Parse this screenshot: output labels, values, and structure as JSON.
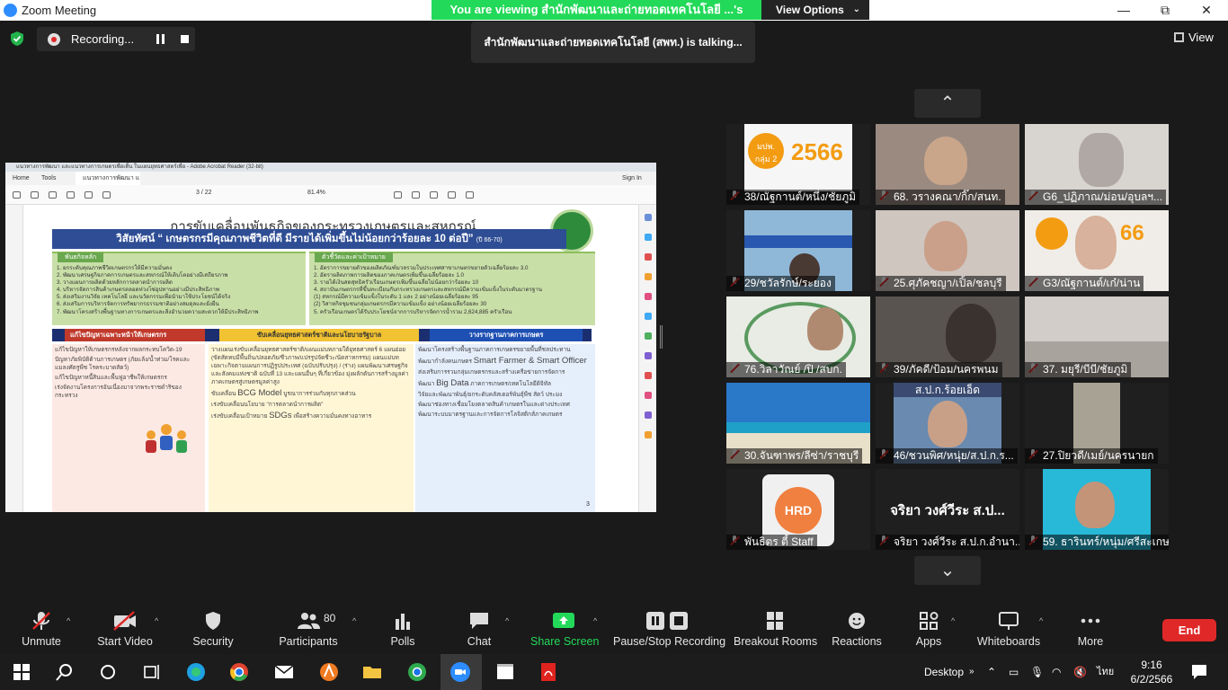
{
  "window": {
    "title": "Zoom Meeting",
    "minimize": "—",
    "restore": "⧉",
    "close": "✕"
  },
  "banner": {
    "viewing_text": "You are viewing สำนักพัฒนาและถ่ายทอดเทคโนโลยี ...'s screen",
    "view_options": "View Options"
  },
  "recording": {
    "label": "Recording..."
  },
  "talking": {
    "text": "สำนักพัฒนาและถ่ายทอดเทคโนโลยี (สพท.) is  talking..."
  },
  "view_button": "View",
  "acrobat": {
    "title": "แนวทางการพัฒนา และแนวทางการเกษตรเพื่อเติ้น ในแผนยุทธศาสตร์เพื่อ - Adobe Acrobat Reader (32-bit)",
    "menu": {
      "home": "Home",
      "tools": "Tools",
      "tab": "แนวทางการพัฒนา และ...",
      "signin": "Sign In"
    },
    "page_indicator": "3 / 22",
    "zoom": "81.4%"
  },
  "slide": {
    "title": "การขับเคลื่อนพันธกิจของกระทรวงเกษตรและสหกรณ์",
    "vision": "วิสัยทัศน์ “ เกษตรกรมีคุณภาพชีวิตที่ดี มีรายได้เพิ่มขึ้นไม่น้อยกว่าร้อยละ 10 ต่อปี”",
    "vision_note": "(ปี 66-70)",
    "mission_header": "พันธกิจหลัก",
    "missions": [
      "1. ยกระดับคุณภาพชีวิตเกษตรกรให้มีความมั่นคง",
      "2. พัฒนาเศรษฐกิจภาคการเกษตรและสหกรณ์ให้เติบโตอย่างมีเสถียรภาพ",
      "3. วางแผนการผลิตด้วยหลักการตลาดนำการผลิต",
      "4. บริหารจัดการสินค้าเกษตรตลอดห่วงโซ่อุปทานอย่างมีประสิทธิภาพ",
      "5. ส่งเสริมงานวิจัย เทคโนโลยี และนวัตกรรมเพื่อนำมาใช้ประโยชน์ได้จริง",
      "6. ส่งเสริมการบริหารจัดการทรัพยากรธรรมชาติอย่างสมดุลและยั่งยืน",
      "7. พัฒนาโครงสร้างพื้นฐานทางการเกษตรและสิ่งอำนวยความสะดวกให้มีประสิทธิภาพ"
    ],
    "indicator_header": "ตัวชี้วัดและค่าเป้าหมาย",
    "indicators": [
      "1. อัตราการขยายตัวของผลิตภัณฑ์มวลรวมในประเทศสาขาเกษตรขยายตัวเฉลี่ยร้อยละ 3.0",
      "2. อัตราผลิตภาพการผลิตของภาคเกษตรเพิ่มขึ้นเฉลี่ยร้อยละ 1.0",
      "3. รายได้เงินสดสุทธิครัวเรือนเกษตรเพิ่มขึ้นเฉลี่ยไม่น้อยกว่าร้อยละ 10",
      "4. สถาบันเกษตรกรที่ขึ้นทะเบียนกับกระทรวงเกษตรและสหกรณ์มีความเข้มแข็งในระดับมาตรฐาน",
      "   (1) สหกรณ์มีความเข้มแข็งในระดับ 1 และ 2 อย่างน้อยเฉลี่ยร้อยละ 95",
      "   (2) วิสาหกิจชุมชนกลุ่มเกษตรกรมีความเข้มแข็ง อย่างน้อยเฉลี่ยร้อยละ 30",
      "5. ครัวเรือนเกษตรได้รับประโยชน์จากการบริหารจัดการน้ำรวม 2,624,885 ครัวเรือน"
    ],
    "bar1": "แก้ไขปัญหาเฉพาะหน้าให้เกษตรกร",
    "bar2": "ขับเคลื่อนยุทธศาสตร์ชาติและนโยบายรัฐบาล",
    "bar3": "วางรากฐานภาคการเกษตร",
    "col1": [
      "แก้ไขปัญหาให้เกษตรกรหลังจากผลกระทบโควิด-19",
      "ปัญหาภัยพิบัติด้านการเกษตร (ภัยแล้ง/น้ำท่วม/โรคและแมลงศัตรูพืช โรคระบาดสัตว์)",
      "แก้ไขปัญหาหนี้สินและพื้นฟูอาชีพให้เกษตรกร",
      "เร่งจัดงานโครงการอันเนื่องมาจากพระราชดำริของกระทรวง"
    ],
    "col2_a": "วางแผนเร่งขับเคลื่อนยุทธศาสตร์ชาติ/แผนแม่บทภายใต้ยุทธศาสตร์ 6 แผนย่อย (ขัดสัดหบมีพื้นถิ่น/ปลอดภัย/ชีวภาพ/แปรรูปจัดชีวะ/นัดสาหกรรม) แผนแม่บทเฉพาะกิจตามแผนการปฏิรูปประเทศ (ฉบับปรับปรุง) / (ร่าง) แผนพัฒนาเศรษฐกิจและสังคมแห่งชาติ ฉบับที่ 13 และแผนอื่นๆ ที่เกี่ยวข้อง มุ่งผลักดันการสร้างมูลค่าภาคเกษตรสู่เกษตรมูลค่าสูง",
    "col2_b_prefix": "ขับเคลื่อน",
    "col2_b_big": "BCG Model",
    "col2_b_suffix": " บูรณาการร่วมกับทุกภาคส่วน",
    "col2_c": "เร่งขับเคลื่อนนโยบาย \"การตลาดนำการผลิต\"",
    "col2_d_prefix": "เร่งขับเคลื่อนเป้าหมาย ",
    "col2_d_big": "SDGs",
    "col2_d_suffix": " เพื่อสร้างความมั่นคงทางอาหาร",
    "col3_a": "พัฒนาโครงสร้างพื้นฐานภาคการเกษตรขยายพื้นที่ชลประทาน",
    "col3_b_prefix": "พัฒนากำลังคนเกษตร ",
    "col3_b_big": "Smart Farmer & Smart Officer",
    "col3_c": "ส่งเสริมการรวมกลุ่มเกษตรกรและสร้างเครือข่ายการจัดการ",
    "col3_d_prefix": "พัฒนา ",
    "col3_d_big": "Big Data",
    "col3_d_suffix": " ภาคการเกษตร/เทคโนโลยีดิจิทัล",
    "col3_e": "วิจัยและพัฒนาพันธุ์/ยกระดับคลัสเตอร์พันธุ์พืช สัตว์ ประมง",
    "col3_f": "พัฒนาช่องทางเชื่อมโยงตลาดสินค้าเกษตรในและต่างประเทศ",
    "col3_g": "พัฒนาระบบมาตรฐานและการจัดการโลจิสติกส์ภาคเกษตร",
    "page_num": "3"
  },
  "participants": [
    {
      "name": "38/ณัฐกานต์/หนึ่ง/ชัยภูมิ"
    },
    {
      "name": "68. วรางคณา/กิ๊ก/สนท."
    },
    {
      "name": "G6_ปฏิภาณ/ม่อน/อุบลฯ..."
    },
    {
      "name": "29/ชวัลรักษ์/ระยอง"
    },
    {
      "name": "25.ศุภัคชญา/เปิ้ล/ชลบุรี"
    },
    {
      "name": "G3/ณัฐกานต์/เก๋/น่าน"
    },
    {
      "name": "76.วิลาวัณย์ /ปิ /สบก."
    },
    {
      "name": "39/ภัคดี/ป้อม/นครพนม"
    },
    {
      "name": "37. มยุรี/บีบี/ชัยภูมิ"
    },
    {
      "name": "30.จันฑาพร/ลีซ่า/ราชบุรี"
    },
    {
      "name": "46/ชวนพิศ/หนุ่ย/ส.ป.ก.ร..."
    },
    {
      "name": "27.ปิยวดี/เมย์/นครนายก"
    },
    {
      "name": "พันธิตร ตี้ Staff"
    },
    {
      "name": "จริยา วงศ์วีระ ส.ป.ก.อำนา..."
    },
    {
      "name": "59. ธารินทร์/หนุ่ม/ศรีสะเกษ"
    }
  ],
  "tile_overlays": {
    "badge_text": "2566",
    "badge_small": "มปพ.",
    "badge_group": "กลุ่ม 2",
    "big_name": "จริยา วงศ์วีระ ส.ป...",
    "hrd": "HRD",
    "spk_banner": "ส.ป.ก.ร้อยเอ็ด"
  },
  "toolbar": {
    "unmute": "Unmute",
    "start_video": "Start Video",
    "security": "Security",
    "participants": "Participants",
    "participant_count": "80",
    "polls": "Polls",
    "chat": "Chat",
    "share_screen": "Share Screen",
    "pause_stop_recording": "Pause/Stop Recording",
    "breakout_rooms": "Breakout Rooms",
    "reactions": "Reactions",
    "apps": "Apps",
    "whiteboards": "Whiteboards",
    "more": "More",
    "end": "End"
  },
  "taskbar": {
    "desktop": "Desktop",
    "lang": "ไทย",
    "time": "9:16",
    "date": "6/2/2566"
  },
  "colors": {
    "share_green": "#23d959",
    "end_red": "#e02828",
    "zoom_blue": "#2d8cff"
  }
}
